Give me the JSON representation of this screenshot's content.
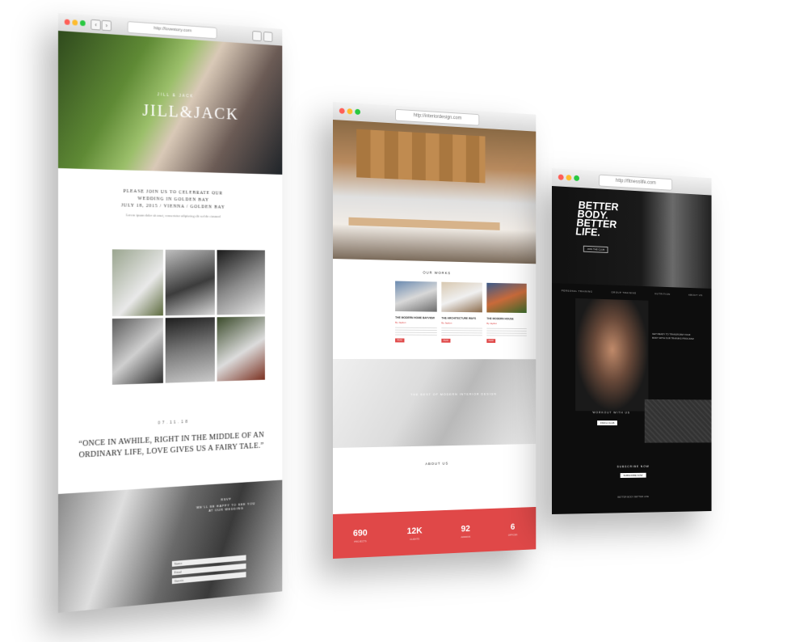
{
  "wedding": {
    "url": "http://lovestory.com",
    "hero_subtitle": "JILL & JACK",
    "hero_title": "JILL&JACK",
    "invite_lines": [
      "PLEASE JOIN US TO CELEBRATE OUR",
      "WEDDING IN GOLDEN BAY",
      "JULY 18, 2015 / VIENNA / GOLDEN BAY"
    ],
    "invite_small": "Lorem ipsum dolor sit amet, consectetur adipiscing elit sed do eiusmod",
    "date_label": "07.11.18",
    "quote": "“ONCE IN AWHILE, RIGHT IN THE MIDDLE OF AN ORDINARY LIFE, LOVE GIVES US A FAIRY TALE.”",
    "rsvp_title": "RSVP",
    "rsvp_text": "WE'LL BE HAPPY TO SEE YOU AT OUR WEDDING",
    "fields": [
      "Name",
      "Email",
      "Guests"
    ]
  },
  "interior": {
    "url": "http://interiordesign.com",
    "section_title": "OUR WORKS",
    "cards": [
      {
        "title": "THE MODERN HOME BAYVIEW",
        "meta": "By Jaydon",
        "button": "READ"
      },
      {
        "title": "THE ARCHITECTURE WAYS",
        "meta": "By Jaydon",
        "button": "READ"
      },
      {
        "title": "THE MODERN HOUSE",
        "meta": "By Jaydon",
        "button": "READ"
      }
    ],
    "mid_caption": "THE BEST OF MODERN INTERIOR DESIGN",
    "about_title": "ABOUT US",
    "stats": [
      {
        "value": "690",
        "label": "PROJECTS"
      },
      {
        "value": "12K",
        "label": "CLIENTS"
      },
      {
        "value": "92",
        "label": "AWARDS"
      },
      {
        "value": "6",
        "label": "OFFICES"
      }
    ],
    "accent": "#e04848"
  },
  "fitness": {
    "url": "http://fitnesslife.com",
    "hero_lines": [
      "BETTER",
      "BODY.",
      "BETTER",
      "LIFE."
    ],
    "hero_cta": "JOIN THE CLUB",
    "nav": [
      "PERSONAL TRAINING",
      "GROUP TRAINING",
      "NUTRITION",
      "ABOUT US"
    ],
    "side_text": "GET READY TO TRANSFORM YOUR BODY WITH OUR TRAINING PROGRAM",
    "about_title": "WORKOUT WITH US",
    "about_button": "FIND A CLUB",
    "subscribe_title": "SUBSCRIBE NOW",
    "subscribe_button": "SUBSCRIBE NOW",
    "footer": "BETTER BODY BETTER LIFE"
  }
}
